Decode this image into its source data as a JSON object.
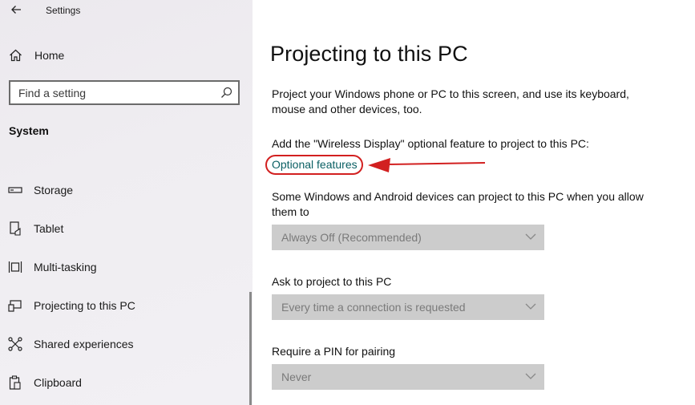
{
  "window": {
    "title": "Settings"
  },
  "sidebar": {
    "home_label": "Home",
    "search_placeholder": "Find a setting",
    "section_title": "System",
    "items": [
      {
        "label": "Storage",
        "icon": "storage-icon"
      },
      {
        "label": "Tablet",
        "icon": "tablet-icon"
      },
      {
        "label": "Multi-tasking",
        "icon": "multitasking-icon"
      },
      {
        "label": "Projecting to this PC",
        "icon": "projecting-icon"
      },
      {
        "label": "Shared experiences",
        "icon": "shared-experiences-icon"
      },
      {
        "label": "Clipboard",
        "icon": "clipboard-icon"
      }
    ]
  },
  "main": {
    "title": "Projecting to this PC",
    "description": "Project your Windows phone or PC to this screen, and use its keyboard, mouse and other devices, too.",
    "feature_prompt": "Add the \"Wireless Display\" optional feature to project to this PC:",
    "optional_features_link": "Optional features",
    "availability_label": "Some Windows and Android devices can project to this PC when you allow them to",
    "availability_value": "Always Off (Recommended)",
    "ask_label": "Ask to project to this PC",
    "ask_value": "Every time a connection is requested",
    "pin_label": "Require a PIN for pairing",
    "pin_value": "Never"
  },
  "colors": {
    "link": "#0a5f63",
    "annotation": "#d22020",
    "dropdown_bg": "#cccccc"
  }
}
